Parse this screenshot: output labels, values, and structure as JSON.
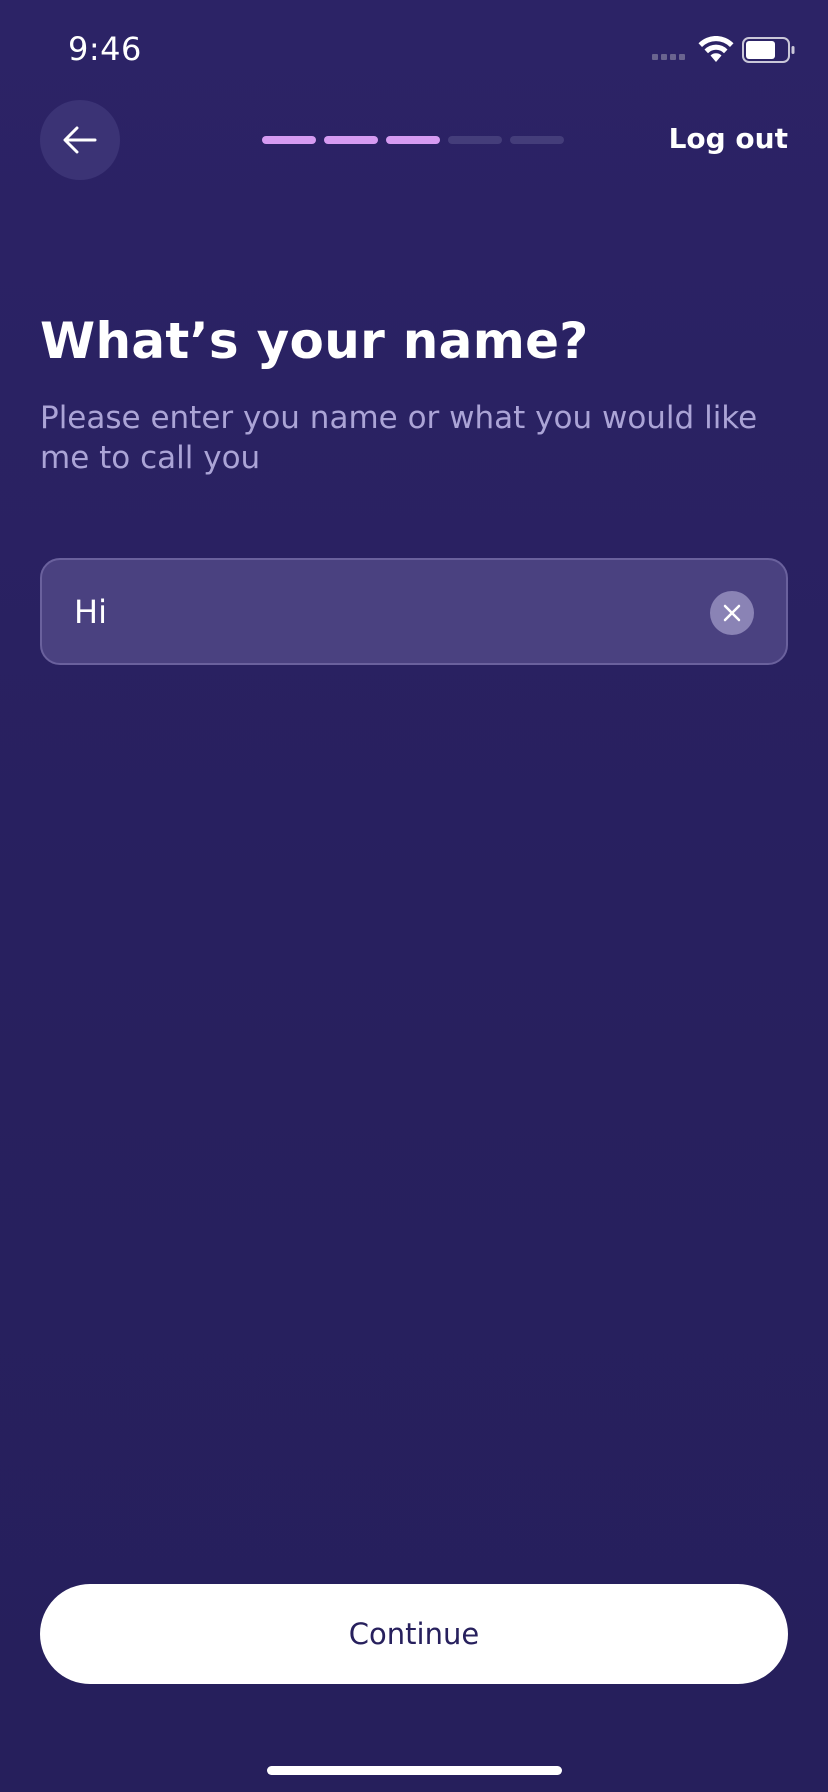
{
  "status_bar": {
    "time": "9:46"
  },
  "header": {
    "back_icon": "arrow-left-icon",
    "progress_total_steps": 5,
    "progress_completed_steps": 3,
    "progress_active_color": "#d69bf2",
    "progress_inactive_color": "#443d7a",
    "logout_label": "Log out"
  },
  "main": {
    "title": "What’s your name?",
    "subtitle": "Please enter you name or what you would like me to call you",
    "name_field": {
      "value": "Hi",
      "clear_icon": "close-icon"
    }
  },
  "footer": {
    "continue_label": "Continue"
  },
  "colors": {
    "background": "#29215f",
    "accent": "#d69bf2",
    "field_background": "#4a4180"
  }
}
